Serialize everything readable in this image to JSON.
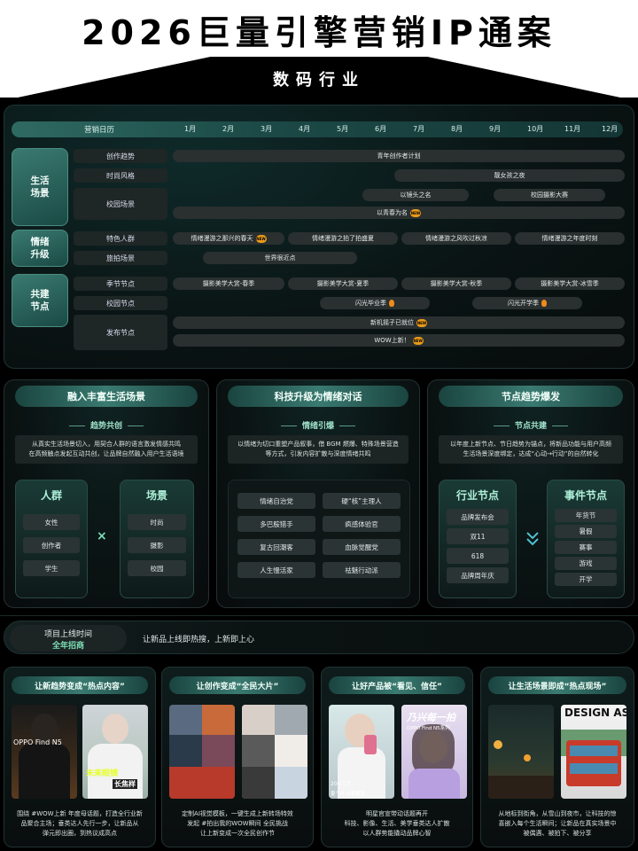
{
  "header": {
    "title": "2026巨量引擎营销IP通案",
    "subtitle": "数码行业"
  },
  "calendar": {
    "title": "营销日历",
    "months": [
      "1月",
      "2月",
      "3月",
      "4月",
      "5月",
      "6月",
      "7月",
      "8月",
      "9月",
      "10月",
      "11月",
      "12月"
    ],
    "categories": {
      "life": "生活\n场景",
      "emotion": "情绪\n升级",
      "cobuild": "共建\n节点"
    },
    "rows": {
      "creation": "创作趋势",
      "fashion": "时尚风格",
      "campus": "校园场景",
      "crowd": "特色人群",
      "travel": "旅拍场景",
      "season": "季节节点",
      "school": "校园节点",
      "release": "发布节点"
    },
    "pills": {
      "youth_plan": "青年创作者计划",
      "hot_girl_night": "靓女孩之夜",
      "lens_name": "以镜头之名",
      "campus_photo": "校园摄影大赛",
      "youth_name": "以青春为名",
      "spring": "情绪漫游之那兴的春天",
      "summer": "情绪漫游之拍了拍盛夏",
      "autumn": "情绪漫游之风吹过秋凉",
      "year_end": "情绪漫游之年度时刻",
      "world_near": "世界很近点",
      "photo_spring": "摄影美学大赏-春季",
      "photo_summer": "摄影美学大赏-夏季",
      "photo_autumn": "摄影美学大赏-秋季",
      "photo_winter": "摄影美学大赏-冰雪季",
      "graduation": "闪光毕业季",
      "school_start": "闪光开学季",
      "new_machine": "新机摇子已就位",
      "wow_new": "WOW上新！",
      "new_badge": "NEW"
    }
  },
  "panels": [
    {
      "title": "融入丰富生活场景",
      "sub": "趋势共创",
      "desc": "从真实生活场景切入，用契合人群的语言激发情感共鸣\n在高频触点发起互动共创，让品牌自然融入用户生活语境",
      "box_left": {
        "title": "人群",
        "items": [
          "女性",
          "创作者",
          "学生"
        ]
      },
      "connector": "×",
      "box_right": {
        "title": "场景",
        "items": [
          "时尚",
          "摄影",
          "校园"
        ]
      }
    },
    {
      "title": "科技升级为情绪对话",
      "sub": "情绪引爆",
      "desc": "以情绪为切口重塑产品叙事，借 BGM 燃爆、特殊场景营造\n等方式，引发内容扩散与深度情绪共鸣",
      "grid": [
        [
          "情绪自治党",
          "硬“核”主理人"
        ],
        [
          "多巴胺猎手",
          "疯感体验官"
        ],
        [
          "复古回潮客",
          "血脉觉醒党"
        ],
        [
          "人生慢活家",
          "祛魅行动派"
        ]
      ]
    },
    {
      "title": "节点趋势爆发",
      "sub": "节点共建",
      "desc": "以年度上新节点、节日趋势为锚点，将新品功能与用户高频\n生活场景深度绑定，达成“心动→行动”的自然转化",
      "box_left": {
        "title": "行业节点",
        "items": [
          "品牌发布会",
          "双11",
          "618",
          "品牌周年庆"
        ]
      },
      "box_right": {
        "title": "事件节点",
        "items": [
          "年货节",
          "暑假",
          "赛事",
          "游戏",
          "开学"
        ]
      }
    }
  ],
  "launch": {
    "tag_line1": "项目上线时间",
    "tag_line2": "全年招商",
    "desc": "让新品上线即热搜，上新即上心"
  },
  "cards": [
    {
      "title": "让新趋势变成“热点内容”",
      "img_text_1": "OPPO Find N5",
      "img_text_2": "未来眼镜",
      "img_text_3": "长焦样",
      "desc": "围绕 #WOW上新 年度母话题，打造全行业新\n品聚合主场；垂类达人先行一步，让新品从\n弹元即出圈，到热议成高点"
    },
    {
      "title": "让创作变成“全民大片”",
      "img_text_1": "",
      "desc": "定制AI视觉模板，一键生成上新转场特效\n发起 #拍出我的WOW瞬间 全民挑战\n让上新变成一次全民创作节"
    },
    {
      "title": "让好产品被“看见、信任”",
      "img_text_1": "乃兴每一拍",
      "img_text_2": "OPPO Find N5系列",
      "img_text_3": "夏个开 N着解密...",
      "img_text_4": "204.7万",
      "desc": "明星官宣带动话题再开\n科技、影像、生活、美学垂类达人扩散\n以人群势能撬动品牌心智"
    },
    {
      "title": "让生活场景即成“热点现场”",
      "img_text_1": "DESIGN AS",
      "desc": "从地标到街角，从雪山到夜市，让科技的惊\n喜嵌入每个生活瞬间；让新品在真实场景中\n被偶遇、被拍下、被分享"
    }
  ]
}
